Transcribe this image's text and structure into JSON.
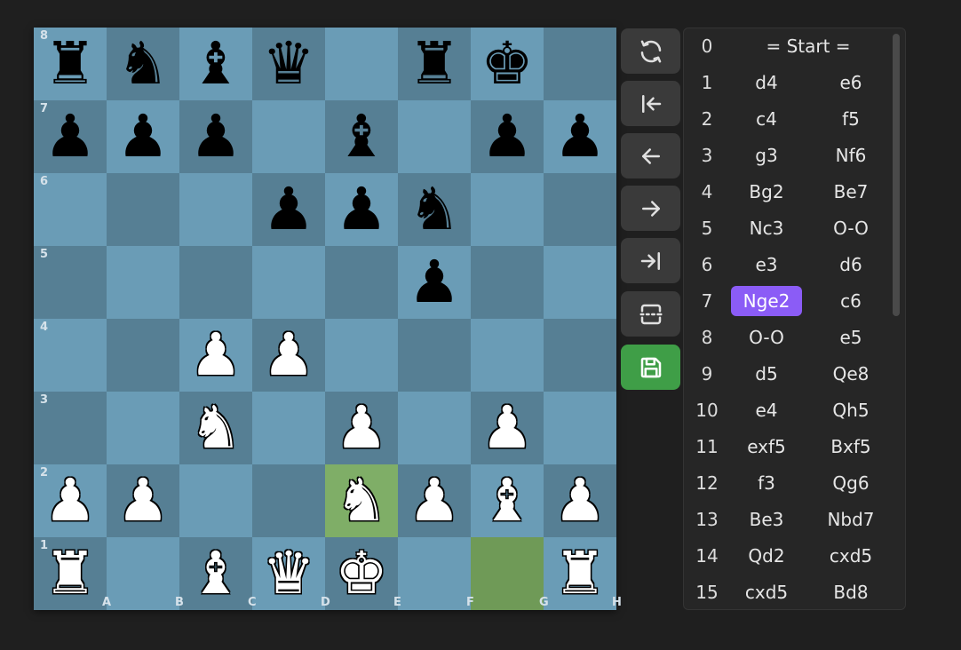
{
  "board": {
    "files": [
      "A",
      "B",
      "C",
      "D",
      "E",
      "F",
      "G",
      "H"
    ],
    "ranks": [
      "8",
      "7",
      "6",
      "5",
      "4",
      "3",
      "2",
      "1"
    ],
    "highlighted_squares": [
      "e2",
      "g1"
    ],
    "light_color": "#6a9cb6",
    "dark_color": "#567f94",
    "highlight_light": "#7fae67",
    "highlight_dark": "#6f9a57",
    "pieces": [
      {
        "sq": "a8",
        "color": "b",
        "type": "rook",
        "glyph": "♜"
      },
      {
        "sq": "b8",
        "color": "b",
        "type": "knight",
        "glyph": "♞"
      },
      {
        "sq": "c8",
        "color": "b",
        "type": "bishop",
        "glyph": "♝"
      },
      {
        "sq": "d8",
        "color": "b",
        "type": "queen",
        "glyph": "♛"
      },
      {
        "sq": "f8",
        "color": "b",
        "type": "rook",
        "glyph": "♜"
      },
      {
        "sq": "g8",
        "color": "b",
        "type": "king",
        "glyph": "♚"
      },
      {
        "sq": "a7",
        "color": "b",
        "type": "pawn",
        "glyph": "♟"
      },
      {
        "sq": "b7",
        "color": "b",
        "type": "pawn",
        "glyph": "♟"
      },
      {
        "sq": "c7",
        "color": "b",
        "type": "pawn",
        "glyph": "♟"
      },
      {
        "sq": "e7",
        "color": "b",
        "type": "bishop",
        "glyph": "♝"
      },
      {
        "sq": "g7",
        "color": "b",
        "type": "pawn",
        "glyph": "♟"
      },
      {
        "sq": "h7",
        "color": "b",
        "type": "pawn",
        "glyph": "♟"
      },
      {
        "sq": "d6",
        "color": "b",
        "type": "pawn",
        "glyph": "♟"
      },
      {
        "sq": "e6",
        "color": "b",
        "type": "pawn",
        "glyph": "♟"
      },
      {
        "sq": "f6",
        "color": "b",
        "type": "knight",
        "glyph": "♞"
      },
      {
        "sq": "f5",
        "color": "b",
        "type": "pawn",
        "glyph": "♟"
      },
      {
        "sq": "c4",
        "color": "w",
        "type": "pawn",
        "glyph": "♟"
      },
      {
        "sq": "d4",
        "color": "w",
        "type": "pawn",
        "glyph": "♟"
      },
      {
        "sq": "c3",
        "color": "w",
        "type": "knight",
        "glyph": "♞"
      },
      {
        "sq": "e3",
        "color": "w",
        "type": "pawn",
        "glyph": "♟"
      },
      {
        "sq": "g3",
        "color": "w",
        "type": "pawn",
        "glyph": "♟"
      },
      {
        "sq": "a2",
        "color": "w",
        "type": "pawn",
        "glyph": "♟"
      },
      {
        "sq": "b2",
        "color": "w",
        "type": "pawn",
        "glyph": "♟"
      },
      {
        "sq": "e2",
        "color": "w",
        "type": "knight",
        "glyph": "♞"
      },
      {
        "sq": "f2",
        "color": "w",
        "type": "pawn",
        "glyph": "♟"
      },
      {
        "sq": "g2",
        "color": "w",
        "type": "bishop",
        "glyph": "♝"
      },
      {
        "sq": "h2",
        "color": "w",
        "type": "pawn",
        "glyph": "♟"
      },
      {
        "sq": "a1",
        "color": "w",
        "type": "rook",
        "glyph": "♜"
      },
      {
        "sq": "c1",
        "color": "w",
        "type": "bishop",
        "glyph": "♝"
      },
      {
        "sq": "d1",
        "color": "w",
        "type": "queen",
        "glyph": "♛"
      },
      {
        "sq": "e1",
        "color": "w",
        "type": "king",
        "glyph": "♚"
      },
      {
        "sq": "h1",
        "color": "w",
        "type": "rook",
        "glyph": "♜"
      }
    ]
  },
  "controls": [
    {
      "name": "flip-board-button",
      "icon": "rotate-icon"
    },
    {
      "name": "first-move-button",
      "icon": "skip-start-icon"
    },
    {
      "name": "prev-move-button",
      "icon": "arrow-left-icon"
    },
    {
      "name": "next-move-button",
      "icon": "arrow-right-icon"
    },
    {
      "name": "last-move-button",
      "icon": "skip-end-icon"
    },
    {
      "name": "split-view-button",
      "icon": "split-dashed-icon"
    },
    {
      "name": "save-button",
      "icon": "floppy-disk-icon"
    }
  ],
  "save_color": "#3f9e47",
  "selected_color": "#8b5cf6",
  "moves": {
    "start_number": "0",
    "start_label": "= Start =",
    "selected": {
      "number": "7",
      "side": "white"
    },
    "rows": [
      {
        "n": "1",
        "w": "d4",
        "b": "e6"
      },
      {
        "n": "2",
        "w": "c4",
        "b": "f5"
      },
      {
        "n": "3",
        "w": "g3",
        "b": "Nf6"
      },
      {
        "n": "4",
        "w": "Bg2",
        "b": "Be7"
      },
      {
        "n": "5",
        "w": "Nc3",
        "b": "O-O"
      },
      {
        "n": "6",
        "w": "e3",
        "b": "d6"
      },
      {
        "n": "7",
        "w": "Nge2",
        "b": "c6"
      },
      {
        "n": "8",
        "w": "O-O",
        "b": "e5"
      },
      {
        "n": "9",
        "w": "d5",
        "b": "Qe8"
      },
      {
        "n": "10",
        "w": "e4",
        "b": "Qh5"
      },
      {
        "n": "11",
        "w": "exf5",
        "b": "Bxf5"
      },
      {
        "n": "12",
        "w": "f3",
        "b": "Qg6"
      },
      {
        "n": "13",
        "w": "Be3",
        "b": "Nbd7"
      },
      {
        "n": "14",
        "w": "Qd2",
        "b": "cxd5"
      },
      {
        "n": "15",
        "w": "cxd5",
        "b": "Bd8"
      }
    ]
  }
}
